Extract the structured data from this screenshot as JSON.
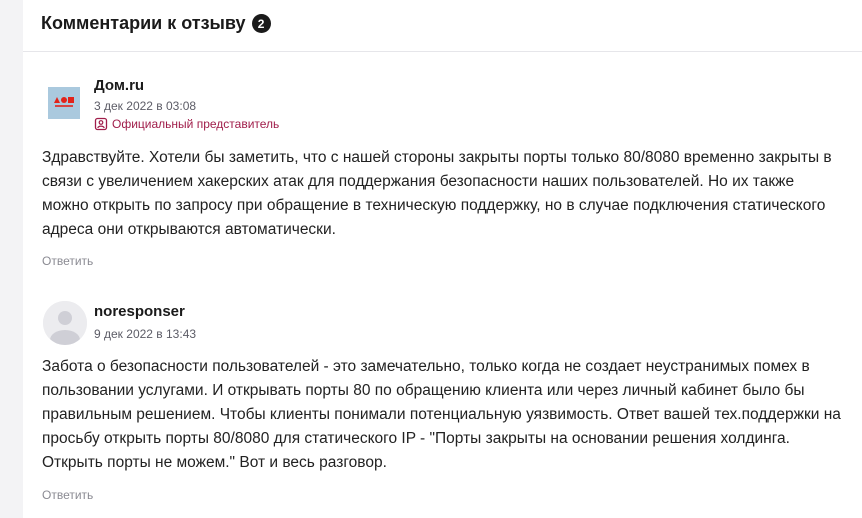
{
  "header": {
    "title": "Комментарии к отзыву",
    "count": "2"
  },
  "comments": [
    {
      "author": "Дом.ru",
      "date": "3 дек 2022 в 03:08",
      "badge": "Официальный представитель",
      "avatar_logo_text": "дом.ru",
      "text": "Здравствуйте. Хотели бы заметить, что с нашей стороны закрыты порты только 80/8080 временно закрыты в связи с увеличением хакерских атак для поддержания безопасности наших пользователей. Но их также можно открыть по запросу при обращение в техническую поддержку, но в случае подключения статического адреса они открываются автоматически.",
      "reply_label": "Ответить"
    },
    {
      "author": "noresponser",
      "date": "9 дек 2022 в 13:43",
      "text": "Забота о безопасности пользователей - это замечательно, только когда не создает неустранимых помех в пользовании услугами. И открывать порты 80 по обращению клиента или через личный кабинет было бы правильным решением. Чтобы клиенты понимали потенциальную уязвимость. Ответ вашей тех.поддержки на просьбу открыть порты 80/8080 для статического IP - \"Порты закрыты на основании решения холдинга. Открыть порты не можем.\" Вот и весь разговор.",
      "reply_label": "Ответить"
    }
  ],
  "colors": {
    "official_badge": "#a01d4a",
    "logo_bg": "#aac9de",
    "logo_red": "#e2231a"
  }
}
